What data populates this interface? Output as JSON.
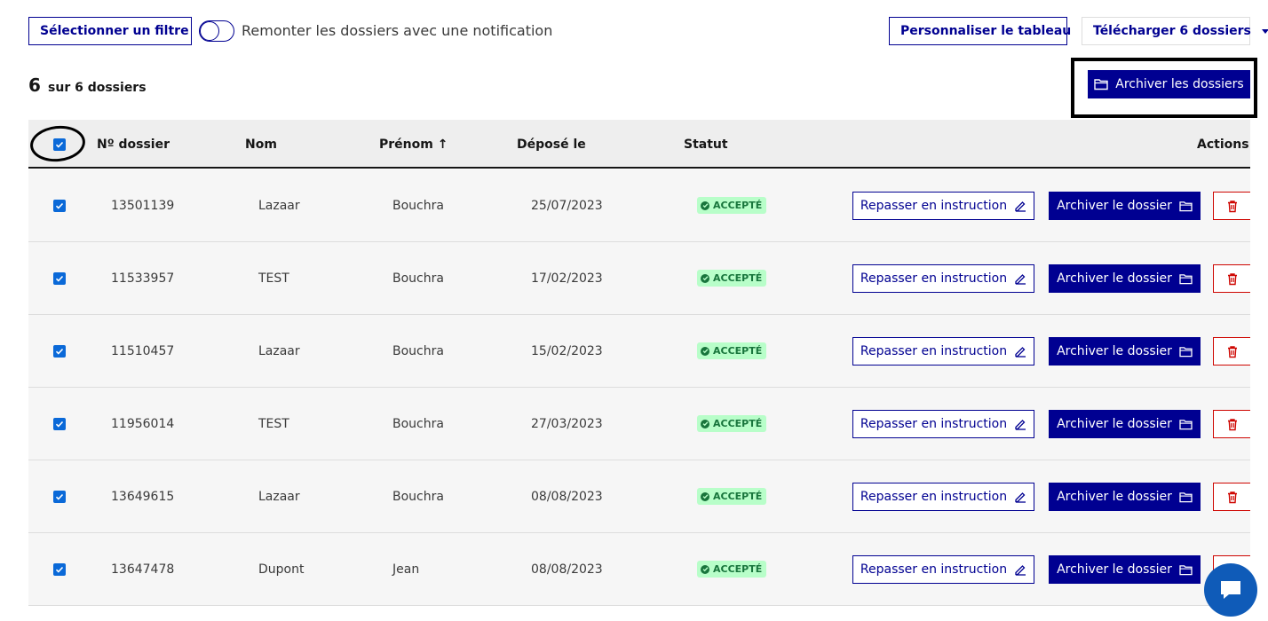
{
  "toolbar": {
    "filter_label": "Sélectionner un filtre",
    "notification_toggle_label": "Remonter les dossiers avec une notification",
    "customize_label": "Personnaliser le tableau",
    "download_label": "Télécharger 6 dossiers"
  },
  "summary": {
    "count": "6",
    "suffix": "sur 6 dossiers"
  },
  "bulk_archive_label": "Archiver les dossiers",
  "table": {
    "headers": {
      "number": "Nº dossier",
      "lastname": "Nom",
      "firstname": "Prénom ↑",
      "date": "Déposé le",
      "status": "Statut",
      "actions": "Actions"
    },
    "rows": [
      {
        "number": "13501139",
        "lastname": "Lazaar",
        "firstname": "Bouchra",
        "date": "25/07/2023",
        "status": "ACCEPTÉ",
        "repasser": "Repasser en instruction",
        "archive": "Archiver le dossier"
      },
      {
        "number": "11533957",
        "lastname": "TEST",
        "firstname": "Bouchra",
        "date": "17/02/2023",
        "status": "ACCEPTÉ",
        "repasser": "Repasser en instruction",
        "archive": "Archiver le dossier"
      },
      {
        "number": "11510457",
        "lastname": "Lazaar",
        "firstname": "Bouchra",
        "date": "15/02/2023",
        "status": "ACCEPTÉ",
        "repasser": "Repasser en instruction",
        "archive": "Archiver le dossier"
      },
      {
        "number": "11956014",
        "lastname": "TEST",
        "firstname": "Bouchra",
        "date": "27/03/2023",
        "status": "ACCEPTÉ",
        "repasser": "Repasser en instruction",
        "archive": "Archiver le dossier"
      },
      {
        "number": "13649615",
        "lastname": "Lazaar",
        "firstname": "Bouchra",
        "date": "08/08/2023",
        "status": "ACCEPTÉ",
        "repasser": "Repasser en instruction",
        "archive": "Archiver le dossier"
      },
      {
        "number": "13647478",
        "lastname": "Dupont",
        "firstname": "Jean",
        "date": "08/08/2023",
        "status": "ACCEPTÉ",
        "repasser": "Repasser en instruction",
        "archive": "Archiver le dossier"
      }
    ]
  },
  "colors": {
    "primary": "#000091",
    "success_bg": "#b8fec9",
    "success_text": "#18753c",
    "danger": "#ce0500",
    "checkbox": "#0a69d8",
    "chat": "#0f5bb8"
  },
  "icons": {
    "dropdown": "caret-down-icon",
    "archive": "folder-icon",
    "edit": "pencil-icon",
    "delete": "trash-icon",
    "status": "check-circle-icon",
    "chat": "chat-bubble-icon"
  }
}
